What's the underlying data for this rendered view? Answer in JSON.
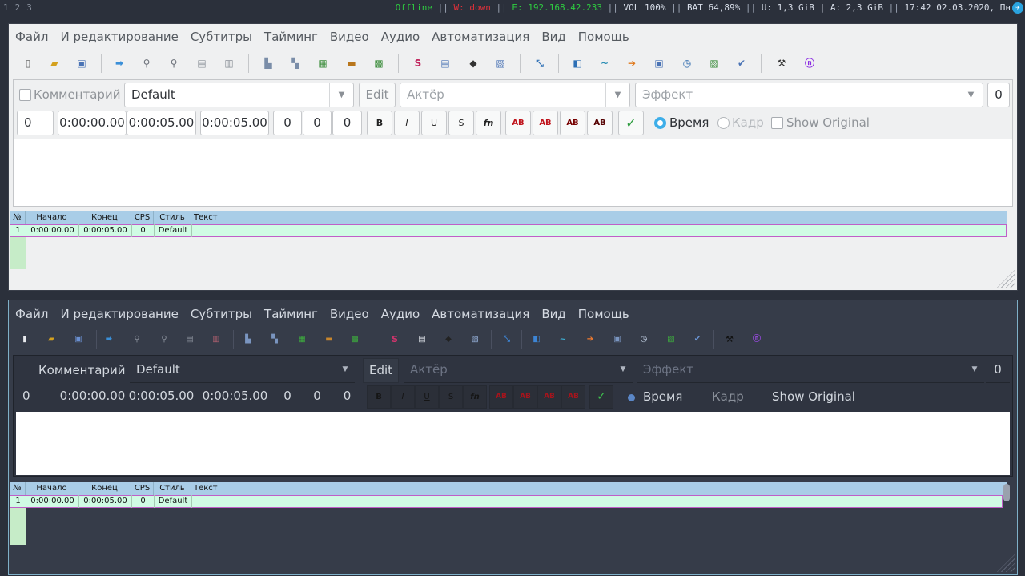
{
  "statusbar": {
    "workspaces": [
      "1",
      "2",
      "3"
    ],
    "offline": "Offline",
    "sep": "||",
    "wifi": "W: down",
    "ethernet": "E: 192.168.42.233",
    "volume": "VOL 100%",
    "battery": "BAT 64,89%",
    "user_mem": "U: 1,3 GiB",
    "bar": "|",
    "avail_mem": "A: 2,3 GiB",
    "datetime": "17:42 02.03.2020, Пн",
    "tray_icon": "telegram-icon"
  },
  "colors": {
    "accent": "#3daee9",
    "offline": "#2ecc40",
    "down": "#e0303a",
    "grid_header": "#a9cde7",
    "grid_row": "#d0fbe4",
    "grid_row_border": "#c05fc8",
    "dark_bg": "#363c49",
    "dark_border": "#7fb0c8"
  },
  "menu": [
    "Файл",
    "И редактирование",
    "Субтитры",
    "Тайминг",
    "Видео",
    "Аудио",
    "Автоматизация",
    "Вид",
    "Помощь"
  ],
  "toolbar": {
    "icons": [
      "new-file-icon",
      "open-folder-icon",
      "save-icon",
      "jump-icon",
      "find-icon",
      "replace-icon",
      "copy-icon",
      "paste-icon",
      "style-manager-icon",
      "attachments-icon",
      "fonts-icon",
      "video-icon",
      "video-details-icon",
      "spell-icon",
      "properties-icon",
      "tag-icon",
      "select-icon",
      "resample-icon",
      "shift-times-icon",
      "timing-post-icon",
      "kanji-timer-icon",
      "translation-icon",
      "resolution-icon",
      "styling-assistant-icon",
      "automation-icon",
      "spellcheck-icon",
      "options-icon",
      "lua-icon"
    ]
  },
  "edit": {
    "comment_label": "Комментарий",
    "style": "Default",
    "edit_button": "Edit",
    "actor_placeholder": "Актёр",
    "effect_placeholder": "Эффект",
    "margin_layer": "0",
    "layer": "0",
    "start_time": "0:00:00.00",
    "end_time": "0:00:05.00",
    "duration": "0:00:05.00",
    "margin_left": "0",
    "margin_right": "0",
    "margin_vert": "0",
    "bold": "B",
    "italic": "I",
    "underline": "U",
    "strike": "S",
    "font": "fn",
    "color1": "AB",
    "color2": "AB",
    "color3": "AB",
    "color4": "AB",
    "commit": "✓",
    "time_label": "Время",
    "frame_label": "Кадр",
    "show_original_label": "Show Original"
  },
  "grid": {
    "headers": {
      "num": "№",
      "start": "Начало",
      "end": "Конец",
      "cps": "CPS",
      "style": "Стиль",
      "text": "Текст"
    },
    "rows": [
      {
        "num": "1",
        "start": "0:00:00.00",
        "end": "0:00:05.00",
        "cps": "0",
        "style": "Default",
        "text": ""
      }
    ]
  }
}
